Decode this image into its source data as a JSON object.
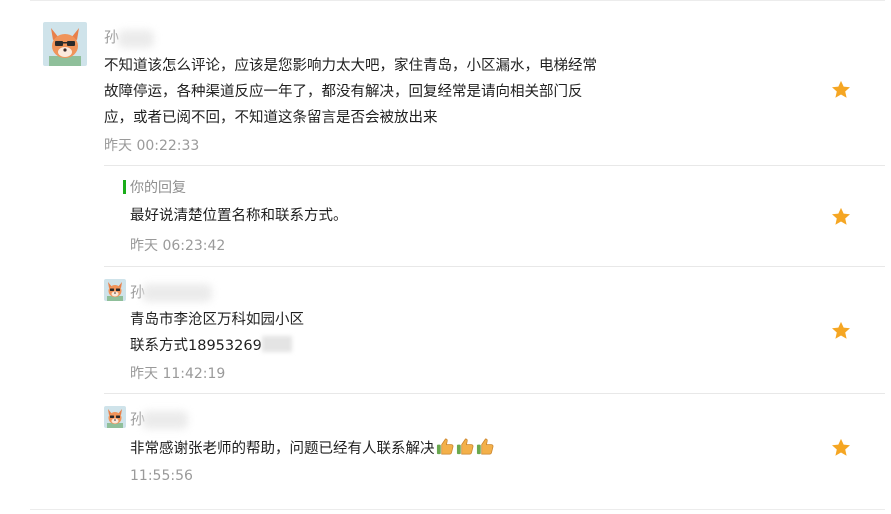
{
  "comment": {
    "author_initial": "孙",
    "text_lines": [
      "不知道该怎么评论，应该是您影响力太大吧，家住青岛，小区漏水，电梯经常",
      "故障停运，各种渠道反应一年了，都没有解决，回复经常是请向相关部门反",
      "应，或者已阅不回，不知道这条留言是否会被放出来"
    ],
    "time": "昨天 00:22:33"
  },
  "reply": {
    "label": "你的回复",
    "text": "最好说清楚位置名称和联系方式。",
    "time": "昨天 06:23:42"
  },
  "followups": [
    {
      "author_initial": "孙",
      "lines": [
        "青岛市李沧区万科如园小区",
        "联系方式18953269"
      ],
      "time": "昨天 11:42:19"
    },
    {
      "author_initial": "孙",
      "lines": [
        "非常感谢张老师的帮助，问题已经有人联系解决"
      ],
      "time": "11:55:56"
    }
  ],
  "icons": {
    "star": "star-icon",
    "thumb": "thumbs-up-icon",
    "avatar": "fox-avatar"
  },
  "colors": {
    "star": "#f5a623",
    "reply_bar": "#1aad19",
    "muted": "#9a9a9a"
  }
}
